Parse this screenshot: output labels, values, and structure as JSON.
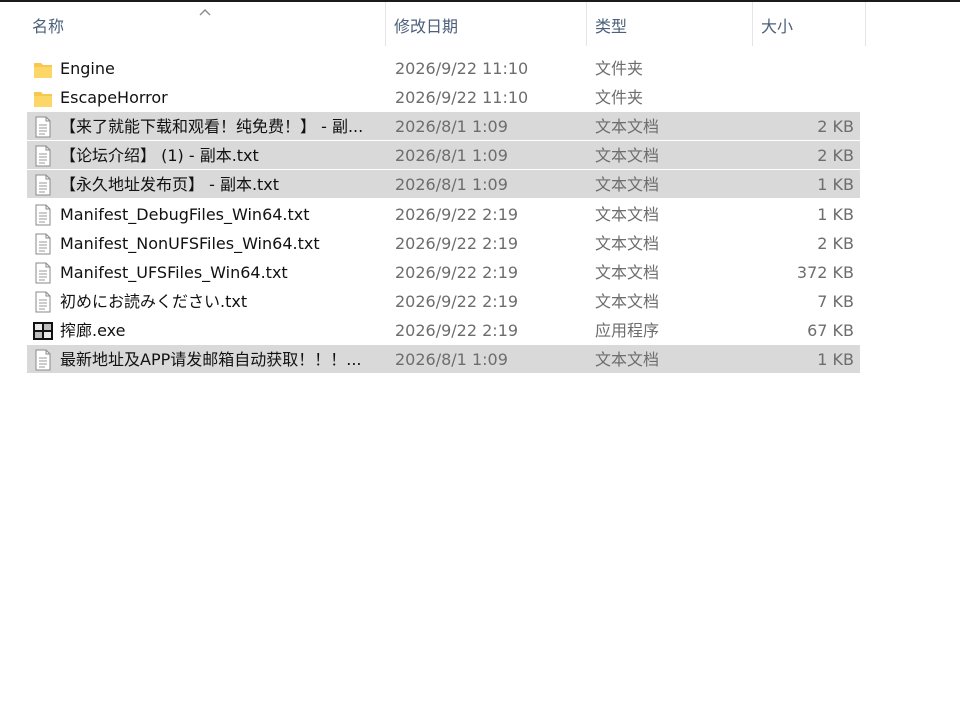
{
  "columns": {
    "name": "名称",
    "date": "修改日期",
    "type": "类型",
    "size": "大小"
  },
  "sort": {
    "column": "name",
    "direction": "ascending",
    "icon": "sort-up-chevron-icon"
  },
  "colors": {
    "header_text": "#4c607a",
    "selection": "#d9d9d9",
    "folder": "#f7c74f",
    "meta_text": "#6d6d6d"
  },
  "files": [
    {
      "name": "Engine",
      "date": "2026/9/22 11:10",
      "type": "文件夹",
      "size": "",
      "icon": "folder-icon",
      "selected": false
    },
    {
      "name": "EscapeHorror",
      "date": "2026/9/22 11:10",
      "type": "文件夹",
      "size": "",
      "icon": "folder-icon",
      "selected": false
    },
    {
      "name": "【来了就能下载和观看！纯免费！】 - 副...",
      "date": "2026/8/1 1:09",
      "type": "文本文档",
      "size": "2 KB",
      "icon": "text-file-icon",
      "selected": true
    },
    {
      "name": "【论坛介绍】 (1) - 副本.txt",
      "date": "2026/8/1 1:09",
      "type": "文本文档",
      "size": "2 KB",
      "icon": "text-file-icon",
      "selected": true
    },
    {
      "name": "【永久地址发布页】 - 副本.txt",
      "date": "2026/8/1 1:09",
      "type": "文本文档",
      "size": "1 KB",
      "icon": "text-file-icon",
      "selected": true
    },
    {
      "name": "Manifest_DebugFiles_Win64.txt",
      "date": "2026/9/22 2:19",
      "type": "文本文档",
      "size": "1 KB",
      "icon": "text-file-icon",
      "selected": false
    },
    {
      "name": "Manifest_NonUFSFiles_Win64.txt",
      "date": "2026/9/22 2:19",
      "type": "文本文档",
      "size": "2 KB",
      "icon": "text-file-icon",
      "selected": false
    },
    {
      "name": "Manifest_UFSFiles_Win64.txt",
      "date": "2026/9/22 2:19",
      "type": "文本文档",
      "size": "372 KB",
      "icon": "text-file-icon",
      "selected": false
    },
    {
      "name": "初めにお読みください.txt",
      "date": "2026/9/22 2:19",
      "type": "文本文档",
      "size": "7 KB",
      "icon": "text-file-icon",
      "selected": false
    },
    {
      "name": "搾廊.exe",
      "date": "2026/9/22 2:19",
      "type": "应用程序",
      "size": "67 KB",
      "icon": "application-icon",
      "selected": false
    },
    {
      "name": "最新地址及APP请发邮箱自动获取！！！...",
      "date": "2026/8/1 1:09",
      "type": "文本文档",
      "size": "1 KB",
      "icon": "text-file-icon",
      "selected": true
    }
  ]
}
